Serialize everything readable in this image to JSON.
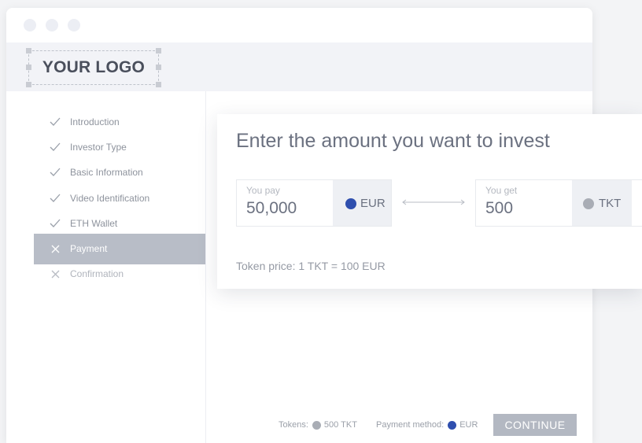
{
  "header": {
    "logo_text": "YOUR LOGO"
  },
  "steps": [
    {
      "label": "Introduction",
      "state": "done"
    },
    {
      "label": "Investor Type",
      "state": "done"
    },
    {
      "label": "Basic Information",
      "state": "done"
    },
    {
      "label": "Video Identification",
      "state": "done"
    },
    {
      "label": "ETH Wallet",
      "state": "done"
    },
    {
      "label": "Payment",
      "state": "active"
    },
    {
      "label": "Confirmation",
      "state": "pending"
    }
  ],
  "card": {
    "title": "Enter the amount you want to invest",
    "pay_label": "You pay",
    "pay_value": "50,000",
    "pay_currency": "EUR",
    "get_label": "You get",
    "get_value": "500",
    "get_currency": "TKT",
    "token_price": "Token price: 1 TKT = 100 EUR"
  },
  "footer": {
    "tokens_label": "Tokens:",
    "tokens_value": "500 TKT",
    "payment_label": "Payment method:",
    "payment_value": "EUR",
    "continue_label": "CONTINUE"
  },
  "colors": {
    "eur_icon": "#2f4fae",
    "tkt_icon": "#a9adb5",
    "active_step": "#b8bdc7",
    "continue_button": "#b3b8c2"
  },
  "icons": {
    "done": "checkmark-icon",
    "active": "x-icon",
    "pending": "x-icon"
  }
}
